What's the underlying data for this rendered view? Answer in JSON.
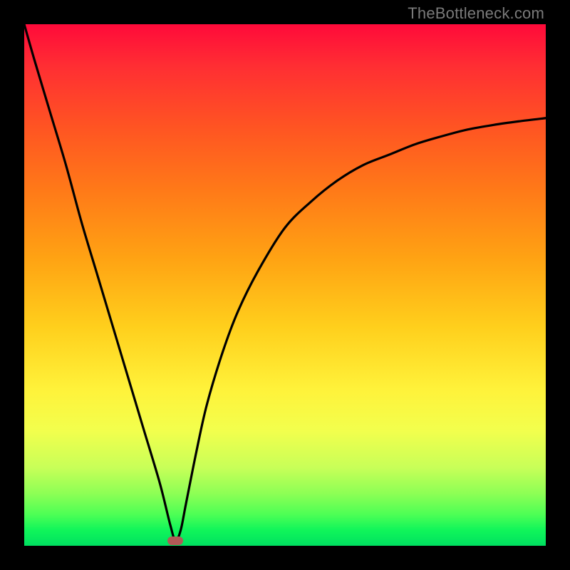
{
  "watermark": "TheBottleneck.com",
  "colors": {
    "frame": "#000000",
    "curve": "#000000",
    "marker": "#b15a57"
  },
  "chart_data": {
    "type": "line",
    "title": "",
    "xlabel": "",
    "ylabel": "",
    "xlim": [
      0,
      100
    ],
    "ylim": [
      0,
      100
    ],
    "grid": false,
    "legend": "none",
    "description": "V-shaped bottleneck curve over red-yellow-green gradient; minimum near x≈29, y≈0; right branch asymptotes near y≈82.",
    "series": [
      {
        "name": "bottleneck-curve",
        "x": [
          0,
          2,
          5,
          8,
          11,
          14,
          17,
          20,
          23,
          26,
          28,
          29,
          30,
          31,
          33,
          35,
          38,
          41,
          45,
          50,
          55,
          60,
          65,
          70,
          75,
          80,
          85,
          90,
          95,
          100
        ],
        "y": [
          100,
          93,
          83,
          73,
          62,
          52,
          42,
          32,
          22,
          12,
          4,
          1,
          3,
          8,
          18,
          27,
          37,
          45,
          53,
          61,
          66,
          70,
          73,
          75,
          77,
          78.5,
          79.8,
          80.7,
          81.4,
          82
        ]
      }
    ],
    "annotations": [
      {
        "name": "min-marker",
        "x": 29,
        "y": 1,
        "shape": "rounded-rect",
        "color": "#b15a57"
      }
    ]
  }
}
